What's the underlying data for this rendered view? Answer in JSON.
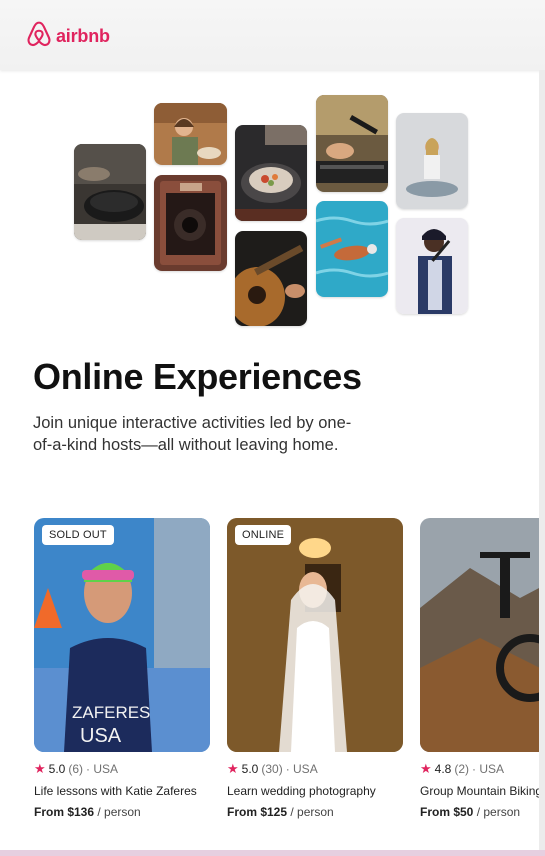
{
  "brand": {
    "name": "airbnb",
    "color": "#e0245e",
    "logo_icon": "airbnb-belo-icon"
  },
  "hero": {
    "title": "Online Experiences",
    "subtitle": "Join unique interactive activities led by one-of-a-kind hosts—all without leaving home."
  },
  "collage": [
    "cooking-pans-photo",
    "woman-baking-photo",
    "vintage-camera-photo",
    "food-plating-photo",
    "guitar-photo",
    "dj-mixing-photo",
    "swimmer-photo",
    "meditation-photo",
    "singer-photo"
  ],
  "cards": [
    {
      "badge": "SOLD OUT",
      "rating": "5.0",
      "reviews": "(6)",
      "location": "· USA",
      "title": "Life lessons with Katie Zaferes",
      "price": "From $136",
      "per": "/ person"
    },
    {
      "badge": "ONLINE",
      "rating": "5.0",
      "reviews": "(30)",
      "location": "· USA",
      "title": "Learn wedding photography",
      "price": "From $125",
      "per": "/ person"
    },
    {
      "badge": "",
      "rating": "4.8",
      "reviews": "(2)",
      "location": "· USA",
      "title": "Group Mountain Biking",
      "price": "From $50",
      "per": "/ person"
    }
  ]
}
